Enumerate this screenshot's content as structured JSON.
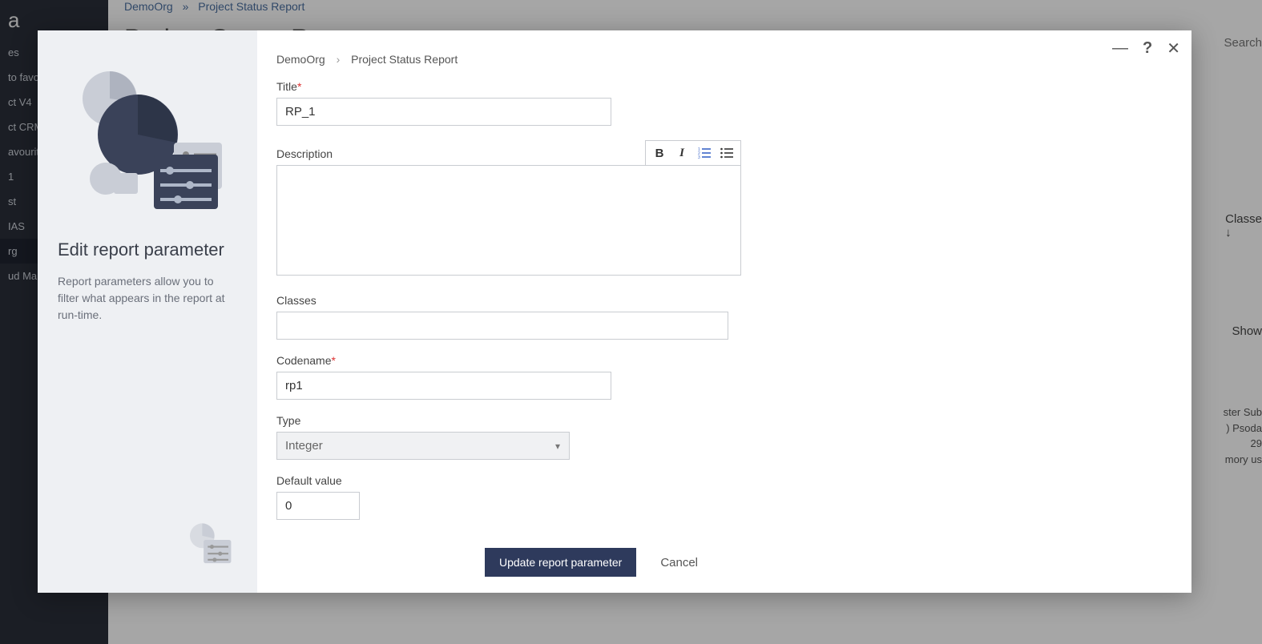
{
  "bg": {
    "breadcrumb_org": "DemoOrg",
    "breadcrumb_sep": "»",
    "breadcrumb_page": "Project Status Report",
    "title": "Project Status Report",
    "search_placeholder": "Search",
    "sidebar_items": [
      "es",
      "to favour",
      "ct V4",
      "ct CRM",
      "avourite",
      "1",
      "st",
      "IAS",
      "rg",
      "ud Mark"
    ],
    "classes_label": "Classe",
    "show_label": "Show",
    "partial_lines": [
      "ster Sub",
      ") Psoda",
      "29",
      "mory us"
    ]
  },
  "modal": {
    "title": "Edit report parameter",
    "subtitle": "Report parameters allow you to filter what appears in the report at run-time.",
    "breadcrumb_org": "DemoOrg",
    "breadcrumb_page": "Project Status Report",
    "labels": {
      "title": "Title",
      "description": "Description",
      "classes": "Classes",
      "codename": "Codename",
      "type": "Type",
      "default_value": "Default value"
    },
    "values": {
      "title": "RP_1",
      "description": "",
      "classes": "",
      "codename": "rp1",
      "type": "Integer",
      "default_value": "0"
    },
    "buttons": {
      "submit": "Update report parameter",
      "cancel": "Cancel"
    },
    "controls": {
      "minimize": "—",
      "help": "?",
      "close": "✕"
    }
  }
}
